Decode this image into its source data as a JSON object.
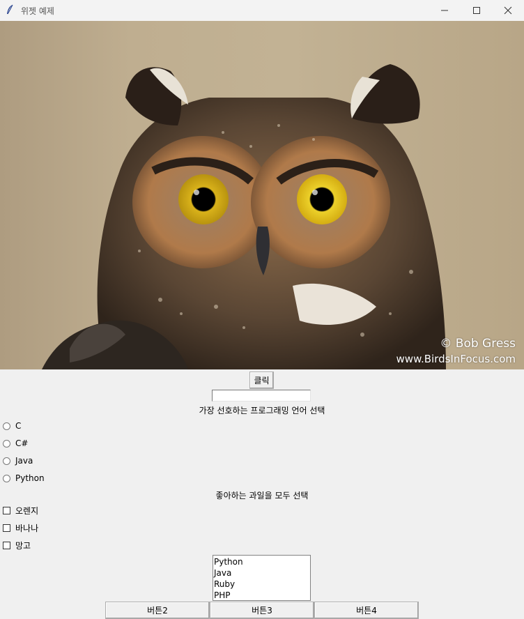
{
  "window": {
    "title": "위젯 예제",
    "app_icon": "feather-icon",
    "controls": [
      "minimize-icon",
      "maximize-icon",
      "close-icon"
    ]
  },
  "image": {
    "subject": "owl-photo",
    "credit_line1": "© Bob Gress",
    "credit_line2": "www.BirdsInFocus.com"
  },
  "click_button": {
    "label": "클릭"
  },
  "entry": {
    "value": ""
  },
  "language_section": {
    "heading": "가장 선호하는 프로그래밍 언어 선택",
    "options": [
      "C",
      "C#",
      "Java",
      "Python"
    ]
  },
  "fruit_section": {
    "heading": "좋아하는 과일을 모두 선택",
    "options": [
      "오렌지",
      "바나나",
      "망고"
    ]
  },
  "listbox": {
    "items": [
      "Python",
      "Java",
      "Ruby",
      "PHP"
    ]
  },
  "bottom_buttons": [
    "버튼2",
    "버튼3",
    "버튼4"
  ]
}
